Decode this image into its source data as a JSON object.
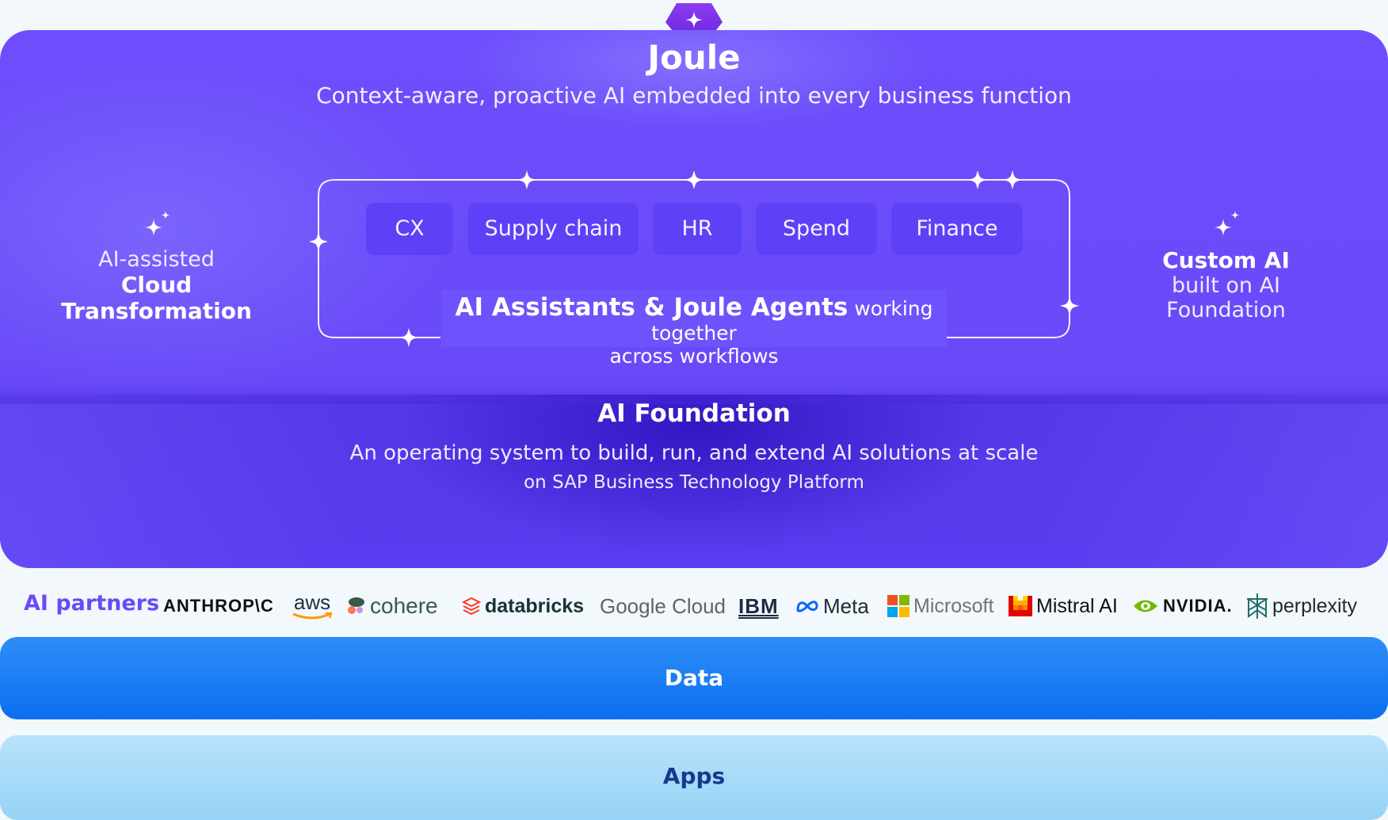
{
  "joule": {
    "title": "Joule",
    "subtitle": "Context-aware, proactive AI embedded into every business function"
  },
  "left_block": {
    "line1": "AI-assisted",
    "line2": "Cloud Transformation",
    "icon": "sparkle-icon"
  },
  "right_block": {
    "line1": "Custom AI",
    "line2": "built on AI Foundation",
    "icon": "sparkle-icon"
  },
  "business_functions": [
    "CX",
    "Supply chain",
    "HR",
    "Spend",
    "Finance"
  ],
  "agents": {
    "bold": "AI Assistants & Joule Agents",
    "rest": "working together",
    "line2": "across workflows"
  },
  "foundation": {
    "title": "AI Foundation",
    "description": "An operating system to build, run, and extend AI solutions at scale",
    "platform": "on SAP Business Technology Platform"
  },
  "partners": {
    "label": "AI partners",
    "items": [
      "ANTHROP\\C",
      "aws",
      "cohere",
      "databricks",
      "Google Cloud",
      "IBM",
      "Meta",
      "Microsoft",
      "Mistral AI",
      "NVIDIA.",
      "perplexity"
    ]
  },
  "layers": {
    "data": "Data",
    "apps": "Apps"
  },
  "colors": {
    "joule_purple": "#6e4efc",
    "foundation_purple": "#3a1fd0",
    "data_blue": "#0b6ff0",
    "apps_light_blue": "#9fd6f8",
    "partners_label": "#6a4af8"
  }
}
